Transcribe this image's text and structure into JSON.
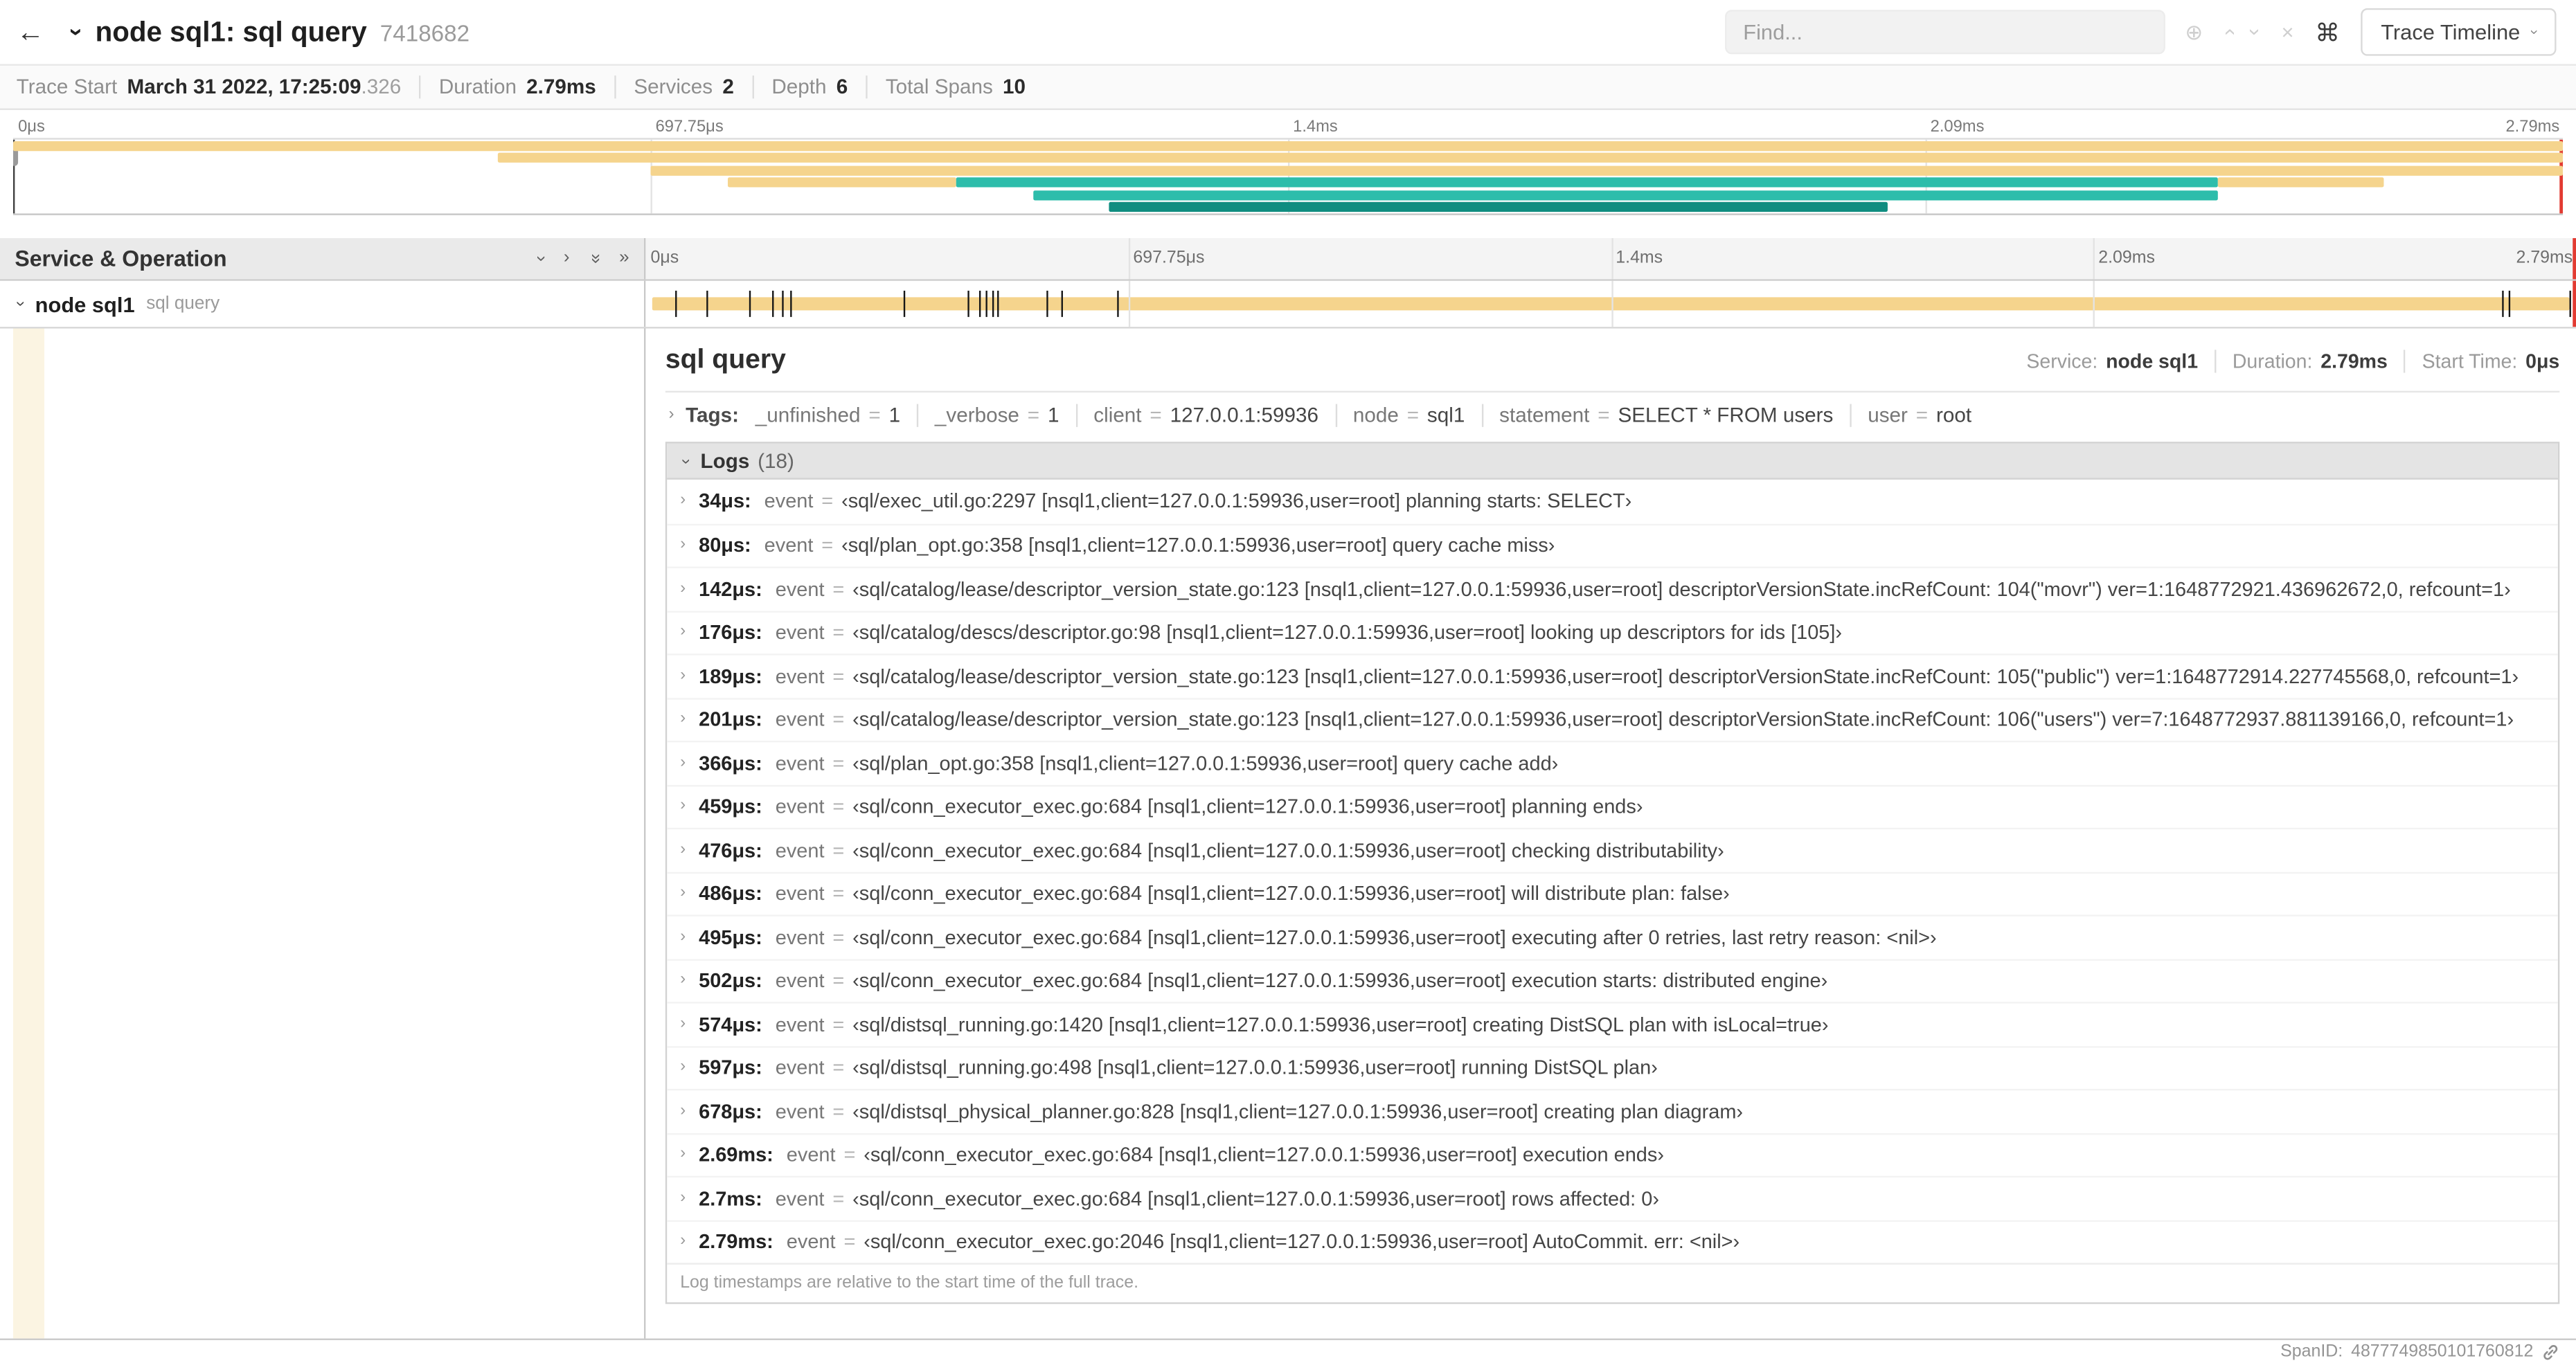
{
  "header": {
    "title": "node sql1: sql query",
    "trace_id": "7418682",
    "find_placeholder": "Find...",
    "view_selector": "Trace Timeline"
  },
  "icons": {
    "back": "←",
    "chevron_r": "›",
    "double_chevron_r": "»",
    "zoom": "⊕",
    "clear": "×",
    "command": "⌘"
  },
  "summary": {
    "items": [
      {
        "label": "Trace Start",
        "value": "March 31 2022, 17:25:09",
        "suffix": ".326"
      },
      {
        "label": "Duration",
        "value": "2.79ms"
      },
      {
        "label": "Services",
        "value": "2"
      },
      {
        "label": "Depth",
        "value": "6"
      },
      {
        "label": "Total Spans",
        "value": "10"
      }
    ]
  },
  "timeline": {
    "duration_us": 2790,
    "ticks": [
      {
        "label": "0μs",
        "pct": 0
      },
      {
        "label": "697.75μs",
        "pct": 25
      },
      {
        "label": "1.4ms",
        "pct": 50
      },
      {
        "label": "2.09ms",
        "pct": 75
      },
      {
        "label": "2.79ms",
        "pct": 100
      }
    ]
  },
  "minimap": {
    "spans": [
      {
        "row": 0,
        "start": 0,
        "end": 100,
        "color": "span_tan"
      },
      {
        "row": 1,
        "start": 19,
        "end": 100,
        "color": "span_tan"
      },
      {
        "row": 2,
        "start": 25,
        "end": 100,
        "color": "span_tan"
      },
      {
        "row": 3,
        "start": 28,
        "end": 37,
        "color": "span_tan"
      },
      {
        "row": 3,
        "start": 37,
        "end": 86.5,
        "color": "span_teal"
      },
      {
        "row": 3,
        "start": 86.5,
        "end": 93,
        "color": "span_tan"
      },
      {
        "row": 4,
        "start": 40,
        "end": 86.5,
        "color": "span_teal"
      },
      {
        "row": 5,
        "start": 43,
        "end": 73.5,
        "color": "span_teal_dark"
      }
    ]
  },
  "tree": {
    "header": "Service & Operation",
    "row": {
      "service": "node sql1",
      "operation": "sql query"
    }
  },
  "detail": {
    "title": "sql query",
    "service_label": "Service:",
    "service": "node sql1",
    "duration_label": "Duration:",
    "duration": "2.79ms",
    "start_label": "Start Time:",
    "start": "0μs",
    "tags_label": "Tags:",
    "tags": [
      {
        "key": "_unfinished",
        "value": "1"
      },
      {
        "key": "_verbose",
        "value": "1"
      },
      {
        "key": "client",
        "value": "127.0.0.1:59936"
      },
      {
        "key": "node",
        "value": "sql1"
      },
      {
        "key": "statement",
        "value": "SELECT * FROM users"
      },
      {
        "key": "user",
        "value": "root"
      }
    ],
    "logs_label": "Logs",
    "logs_count": "(18)",
    "logs": [
      {
        "time": "34μs:",
        "t_us": 34,
        "field": "event",
        "value": "‹sql/exec_util.go:2297 [nsql1,client=127.0.0.1:59936,user=root] planning starts: SELECT›"
      },
      {
        "time": "80μs:",
        "t_us": 80,
        "field": "event",
        "value": "‹sql/plan_opt.go:358 [nsql1,client=127.0.0.1:59936,user=root] query cache miss›"
      },
      {
        "time": "142μs:",
        "t_us": 142,
        "field": "event",
        "value": "‹sql/catalog/lease/descriptor_version_state.go:123 [nsql1,client=127.0.0.1:59936,user=root] descriptorVersionState.incRefCount: 104(\"movr\") ver=1:1648772921.436962672,0, refcount=1›"
      },
      {
        "time": "176μs:",
        "t_us": 176,
        "field": "event",
        "value": "‹sql/catalog/descs/descriptor.go:98 [nsql1,client=127.0.0.1:59936,user=root] looking up descriptors for ids [105]›"
      },
      {
        "time": "189μs:",
        "t_us": 189,
        "field": "event",
        "value": "‹sql/catalog/lease/descriptor_version_state.go:123 [nsql1,client=127.0.0.1:59936,user=root] descriptorVersionState.incRefCount: 105(\"public\") ver=1:1648772914.227745568,0, refcount=1›"
      },
      {
        "time": "201μs:",
        "t_us": 201,
        "field": "event",
        "value": "‹sql/catalog/lease/descriptor_version_state.go:123 [nsql1,client=127.0.0.1:59936,user=root] descriptorVersionState.incRefCount: 106(\"users\") ver=7:1648772937.881139166,0, refcount=1›"
      },
      {
        "time": "366μs:",
        "t_us": 366,
        "field": "event",
        "value": "‹sql/plan_opt.go:358 [nsql1,client=127.0.0.1:59936,user=root] query cache add›"
      },
      {
        "time": "459μs:",
        "t_us": 459,
        "field": "event",
        "value": "‹sql/conn_executor_exec.go:684 [nsql1,client=127.0.0.1:59936,user=root] planning ends›"
      },
      {
        "time": "476μs:",
        "t_us": 476,
        "field": "event",
        "value": "‹sql/conn_executor_exec.go:684 [nsql1,client=127.0.0.1:59936,user=root] checking distributability›"
      },
      {
        "time": "486μs:",
        "t_us": 486,
        "field": "event",
        "value": "‹sql/conn_executor_exec.go:684 [nsql1,client=127.0.0.1:59936,user=root] will distribute plan: false›"
      },
      {
        "time": "495μs:",
        "t_us": 495,
        "field": "event",
        "value": "‹sql/conn_executor_exec.go:684 [nsql1,client=127.0.0.1:59936,user=root] executing after 0 retries, last retry reason: <nil>›"
      },
      {
        "time": "502μs:",
        "t_us": 502,
        "field": "event",
        "value": "‹sql/conn_executor_exec.go:684 [nsql1,client=127.0.0.1:59936,user=root] execution starts: distributed engine›"
      },
      {
        "time": "574μs:",
        "t_us": 574,
        "field": "event",
        "value": "‹sql/distsql_running.go:1420 [nsql1,client=127.0.0.1:59936,user=root] creating DistSQL plan with isLocal=true›"
      },
      {
        "time": "597μs:",
        "t_us": 597,
        "field": "event",
        "value": "‹sql/distsql_running.go:498 [nsql1,client=127.0.0.1:59936,user=root] running DistSQL plan›"
      },
      {
        "time": "678μs:",
        "t_us": 678,
        "field": "event",
        "value": "‹sql/distsql_physical_planner.go:828 [nsql1,client=127.0.0.1:59936,user=root] creating plan diagram›"
      },
      {
        "time": "2.69ms:",
        "t_us": 2690,
        "field": "event",
        "value": "‹sql/conn_executor_exec.go:684 [nsql1,client=127.0.0.1:59936,user=root] execution ends›"
      },
      {
        "time": "2.7ms:",
        "t_us": 2700,
        "field": "event",
        "value": "‹sql/conn_executor_exec.go:684 [nsql1,client=127.0.0.1:59936,user=root] rows affected: 0›"
      },
      {
        "time": "2.79ms:",
        "t_us": 2790,
        "field": "event",
        "value": "‹sql/conn_executor_exec.go:2046 [nsql1,client=127.0.0.1:59936,user=root] AutoCommit. err: <nil>›"
      }
    ],
    "footer_note": "Log timestamps are relative to the start time of the full trace.",
    "span_id_label": "SpanID:",
    "span_id": "4877749850101760812"
  },
  "colors": {
    "span_tan": "#f5d48d",
    "span_teal": "#2dbdab",
    "span_teal_dark": "#108d80",
    "scrubber_red": "#e23b32",
    "indent_cream": "#fbf4e2"
  }
}
